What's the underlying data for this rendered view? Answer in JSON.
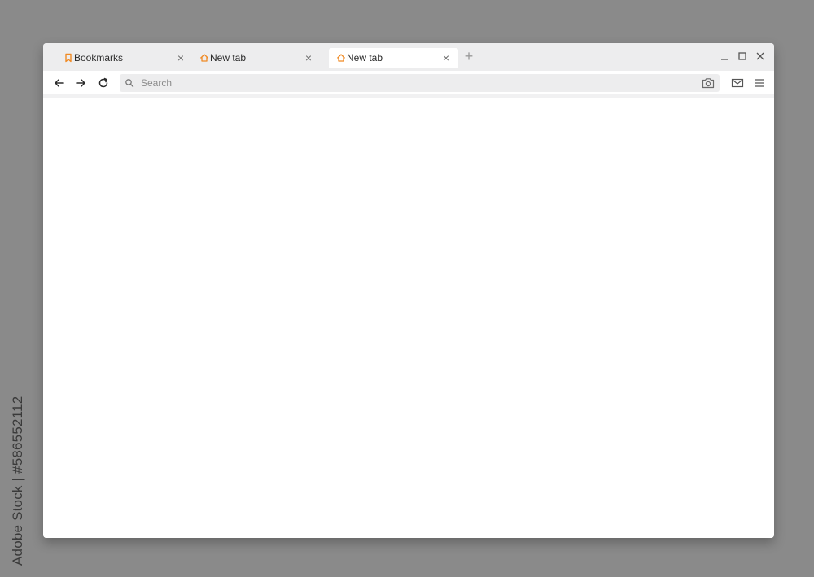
{
  "browser": {
    "tabs": [
      {
        "label": "Bookmarks",
        "icon": "bookmark-icon",
        "active": false
      },
      {
        "label": "New tab",
        "icon": "home-icon",
        "active": false
      },
      {
        "label": "New tab",
        "icon": "home-icon",
        "active": true
      }
    ],
    "new_tab_glyph": "+",
    "close_glyph": "×",
    "search": {
      "placeholder": "Search",
      "value": ""
    },
    "accent_color": "#f08a24"
  },
  "watermark": {
    "side_text": "Adobe Stock | #586552112"
  }
}
